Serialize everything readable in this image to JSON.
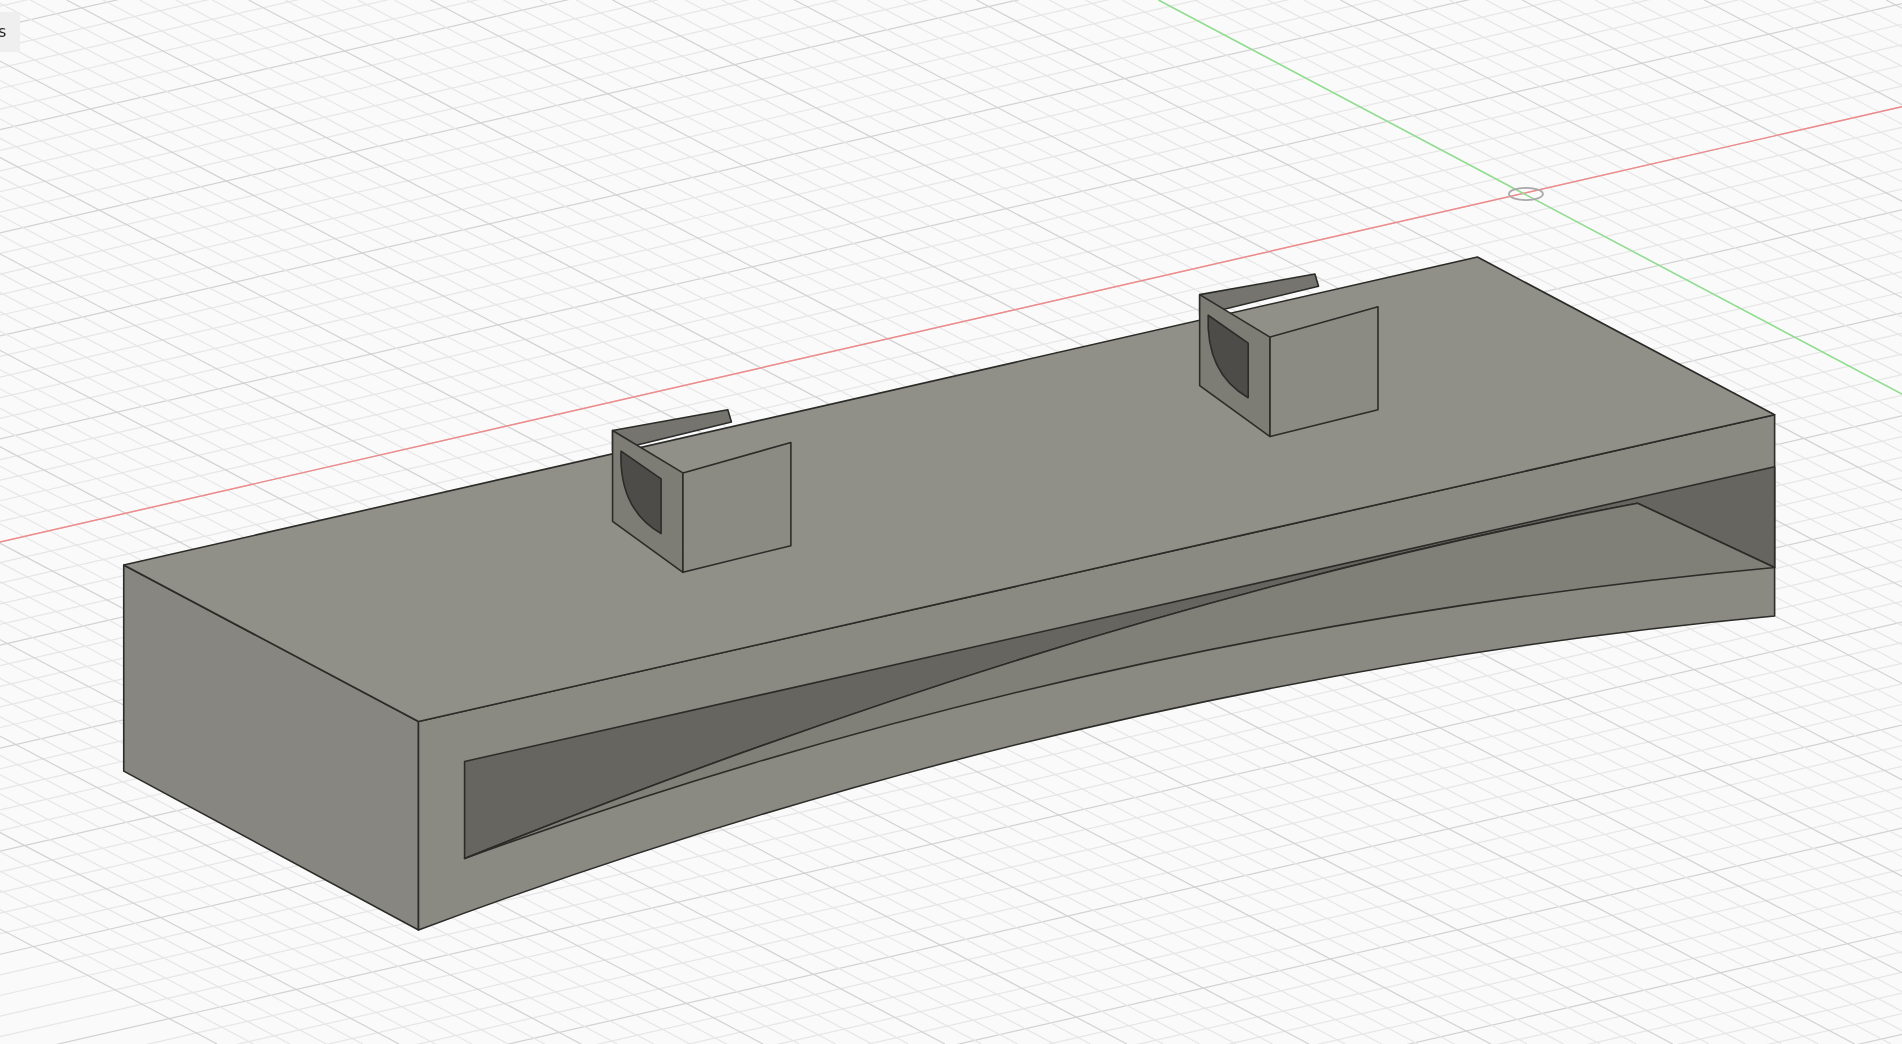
{
  "corner_label": {
    "text": "s"
  }
}
